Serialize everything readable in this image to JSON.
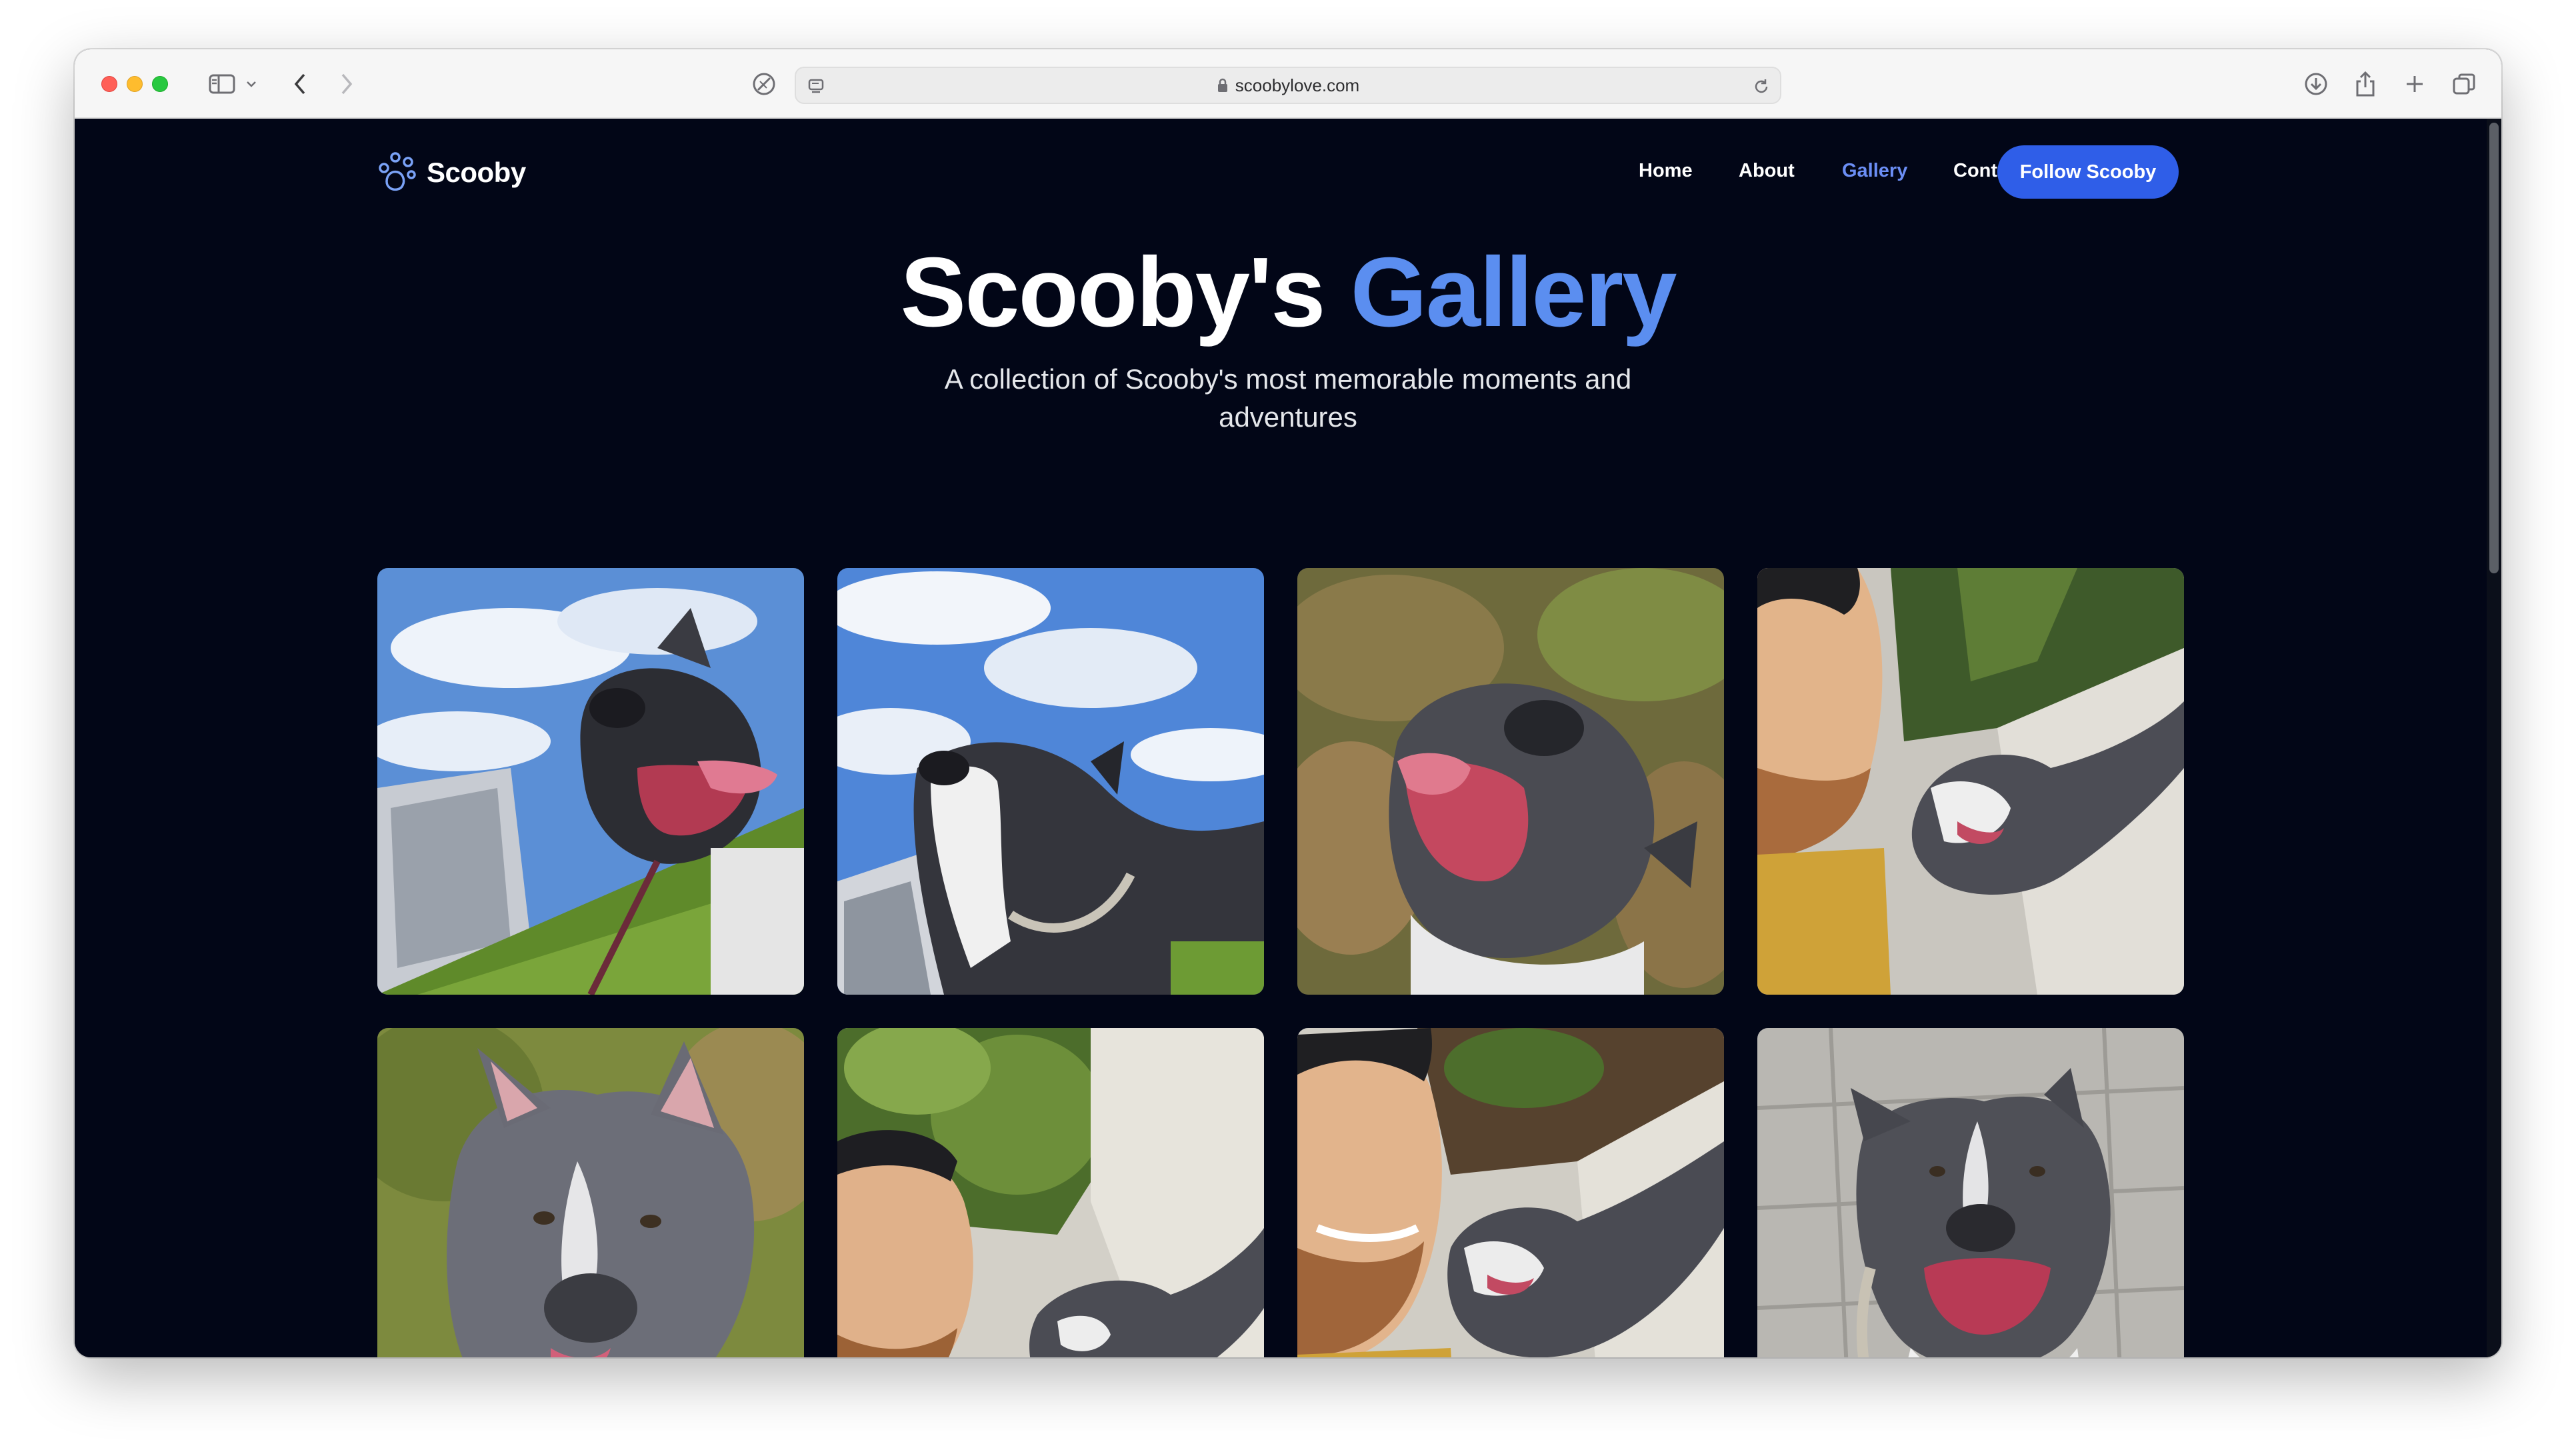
{
  "browser": {
    "url": "scoobylove.com"
  },
  "site": {
    "logo_text": "Scooby",
    "nav": {
      "home": "Home",
      "about": "About",
      "gallery": "Gallery",
      "contact": "Contact"
    },
    "follow_button": "Follow Scooby"
  },
  "hero": {
    "title_part1": "Scooby's",
    "title_part2": "Gallery",
    "subtitle": "A collection of Scooby's most memorable moments and adventures"
  },
  "colors": {
    "page_background": "#020617",
    "accent": "#5b8ef0",
    "button": "#2f5ee8"
  },
  "gallery": {
    "photos": [
      {
        "subject": "dog-on-grass-sky"
      },
      {
        "subject": "dog-looking-up-sky"
      },
      {
        "subject": "dog-closeup-leaves"
      },
      {
        "subject": "selfie-man-dog-sidewalk"
      },
      {
        "subject": "dog-portrait-grass"
      },
      {
        "subject": "selfie-man-dog-bushes"
      },
      {
        "subject": "selfie-man-dog-smiling"
      },
      {
        "subject": "dog-on-pavers"
      }
    ]
  }
}
